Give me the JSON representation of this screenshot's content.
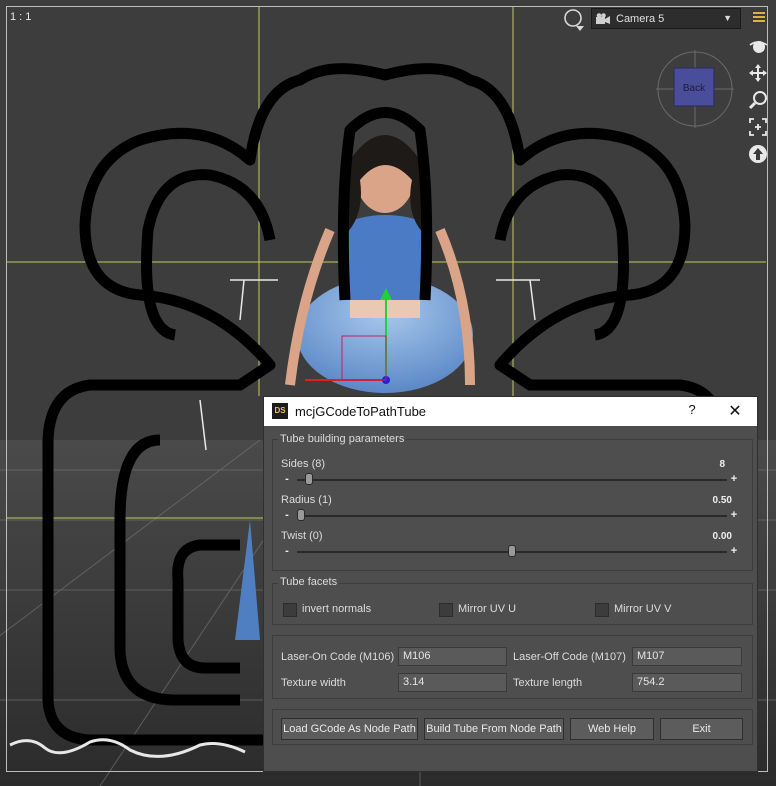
{
  "viewport": {
    "ratio_label": "1 : 1",
    "camera_select": "Camera 5",
    "cube_face_label": "Back",
    "colors": {
      "background": "#3a3a3a",
      "guide": "#c8c85a",
      "outline": "#000000"
    }
  },
  "dialog": {
    "title": "mcjGCodeToPathTube",
    "help_label": "?",
    "close_label": "✕",
    "tube_params": {
      "title": "Tube building parameters",
      "sides": {
        "label": "Sides (8)",
        "value": "8",
        "fraction": 0.02
      },
      "radius": {
        "label": "Radius (1)",
        "value": "0.50",
        "fraction": 0.0
      },
      "twist": {
        "label": "Twist (0)",
        "value": "0.00",
        "fraction": 0.5
      }
    },
    "tube_facets": {
      "title": "Tube facets",
      "invert_normals": "invert normals",
      "mirror_u": "Mirror UV U",
      "mirror_v": "Mirror UV V"
    },
    "codes": {
      "laser_on_label": "Laser-On Code (M106)",
      "laser_on_value": "M106",
      "laser_off_label": "Laser-Off Code (M107)",
      "laser_off_value": "M107",
      "texture_width_label": "Texture width",
      "texture_width_value": "3.14",
      "texture_length_label": "Texture length",
      "texture_length_value": "754.2"
    },
    "buttons": {
      "load": "Load GCode As Node Path",
      "build": "Build Tube From Node Path",
      "help": "Web Help",
      "exit": "Exit"
    }
  }
}
